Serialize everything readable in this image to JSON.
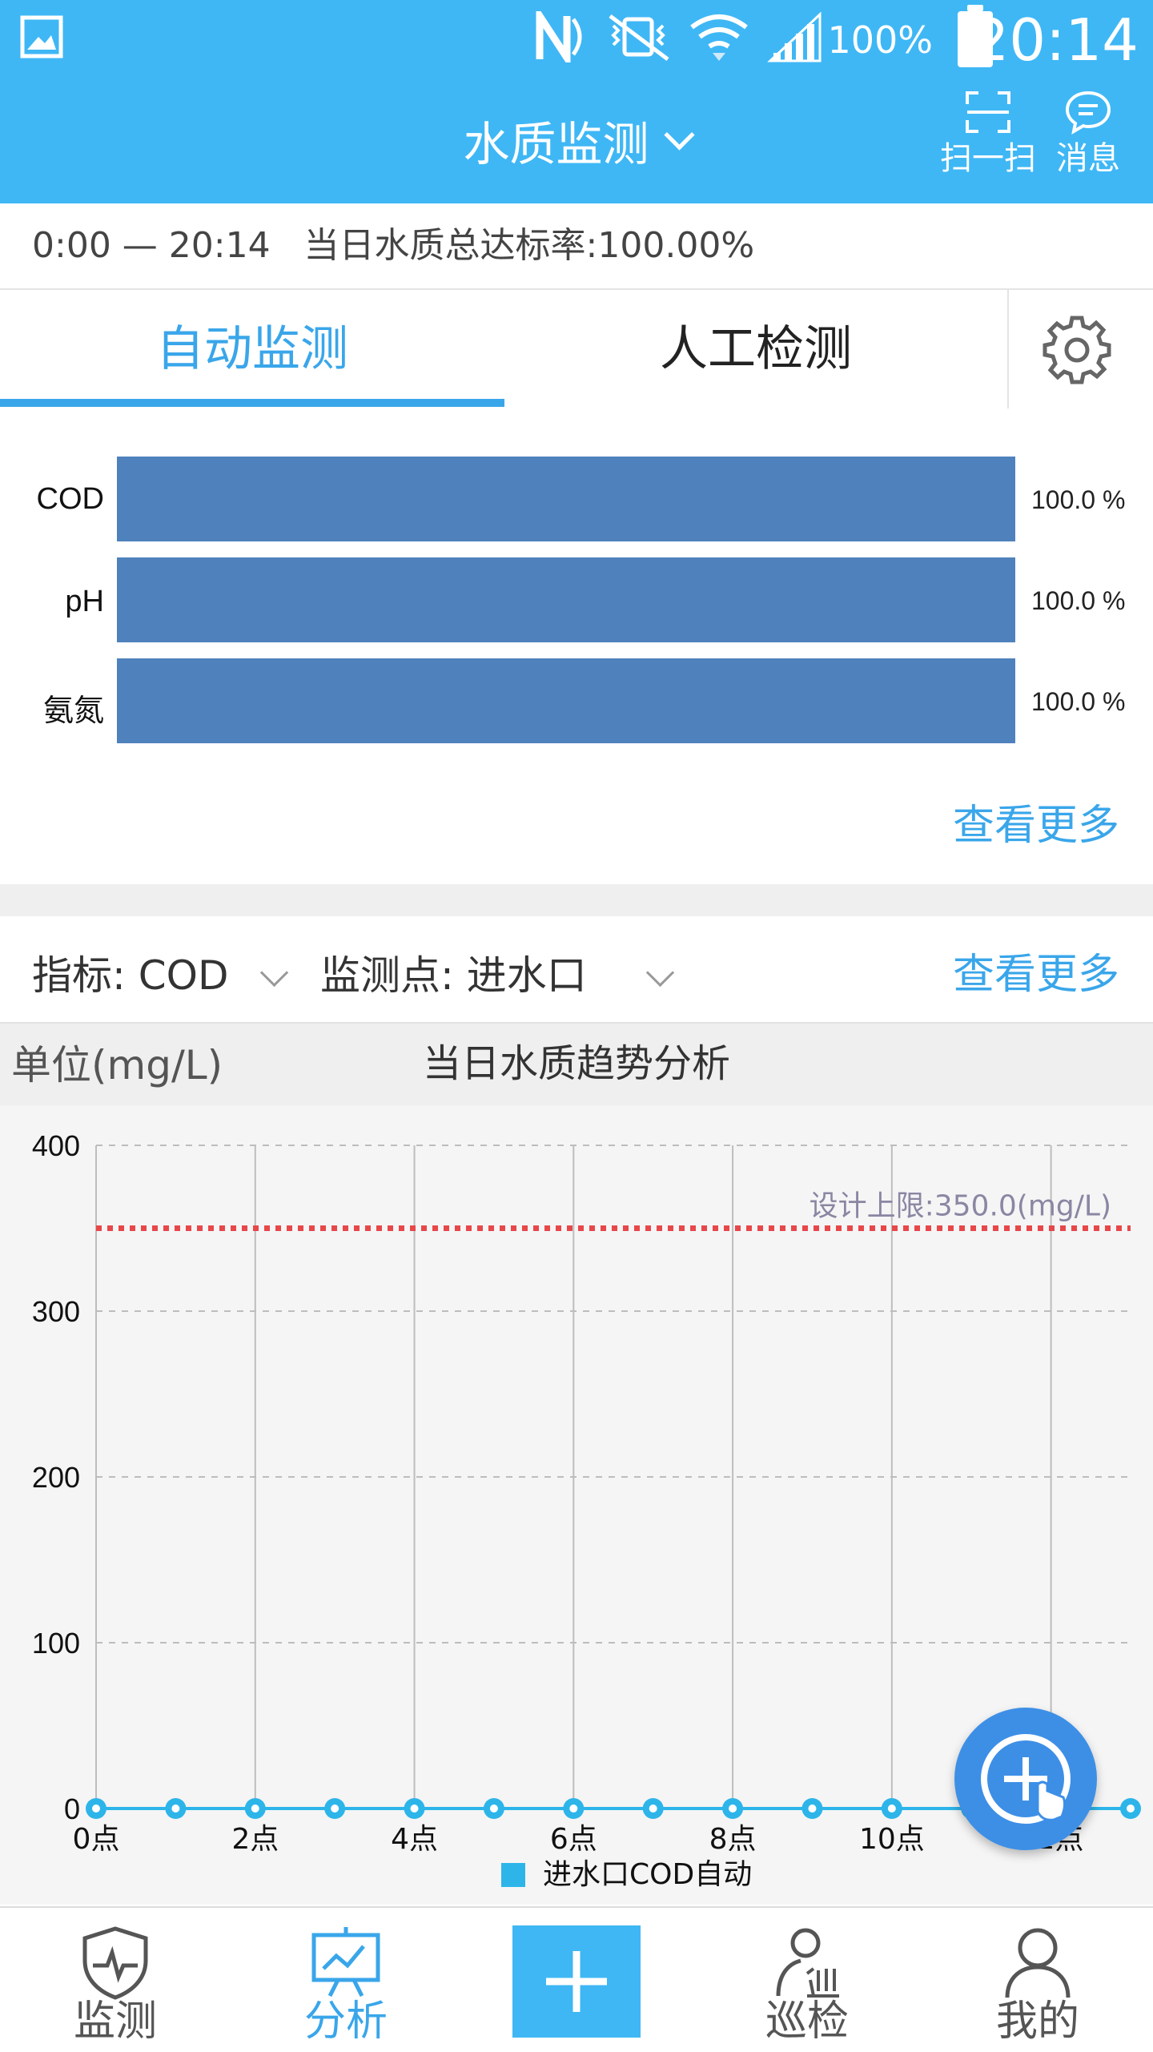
{
  "status": {
    "battery": "100%",
    "time": "20:14"
  },
  "app": {
    "title": "水质监测",
    "scan_label": "扫一扫",
    "message_label": "消息"
  },
  "summary": {
    "text": "0:00 — 20:14   当日水质总达标率:100.00%"
  },
  "tabs": [
    {
      "label": "自动监测"
    },
    {
      "label": "人工检测"
    }
  ],
  "compliance": {
    "more_label": "查看更多",
    "chart_data": {
      "type": "bar",
      "orientation": "horizontal",
      "categories": [
        "COD",
        "pH",
        "氨氮"
      ],
      "values": [
        100.0,
        100.0,
        100.0
      ],
      "value_labels": [
        "100.0 %",
        "100.0 %",
        "100.0 %"
      ],
      "xlim": [
        0,
        100
      ]
    }
  },
  "selectors": {
    "indicator_label": "指标: COD",
    "point_label": "监测点: 进水口",
    "more_label": "查看更多"
  },
  "trend": {
    "unit": "单位(mg/L)",
    "title": "当日水质趋势分析",
    "chart_data": {
      "type": "line",
      "x": [
        0,
        1,
        2,
        3,
        4,
        5,
        6,
        7,
        8,
        9,
        10,
        11,
        12,
        13
      ],
      "series": [
        {
          "name": "进水口COD自动",
          "values": [
            0,
            0,
            0,
            0,
            0,
            0,
            0,
            0,
            0,
            0,
            0,
            0,
            0,
            0
          ],
          "color": "#2db5ea"
        }
      ],
      "x_tick_values": [
        0,
        2,
        4,
        6,
        8,
        10,
        12
      ],
      "x_tick_labels": [
        "0点",
        "2点",
        "4点",
        "6点",
        "8点",
        "10点",
        "12点"
      ],
      "y_ticks": [
        0,
        100,
        200,
        300,
        400
      ],
      "ylim": [
        0,
        400
      ],
      "xlim": [
        0,
        13
      ],
      "limit_line": {
        "value": 350.0,
        "label": "设计上限:350.0(mg/L)",
        "color": "#e8474a"
      },
      "grid": true,
      "legend": "bottom"
    }
  },
  "nav": [
    {
      "label": "监测",
      "icon": "shield-pulse-icon"
    },
    {
      "label": "分析",
      "icon": "chart-presentation-icon"
    },
    {
      "label": "",
      "icon": "plus-icon"
    },
    {
      "label": "巡检",
      "icon": "patrol-icon"
    },
    {
      "label": "我的",
      "icon": "user-icon"
    }
  ],
  "colors": {
    "primary": "#3fb7f5",
    "accent": "#3aa6ea",
    "bar": "#4f81bd",
    "limit": "#e8474a"
  }
}
